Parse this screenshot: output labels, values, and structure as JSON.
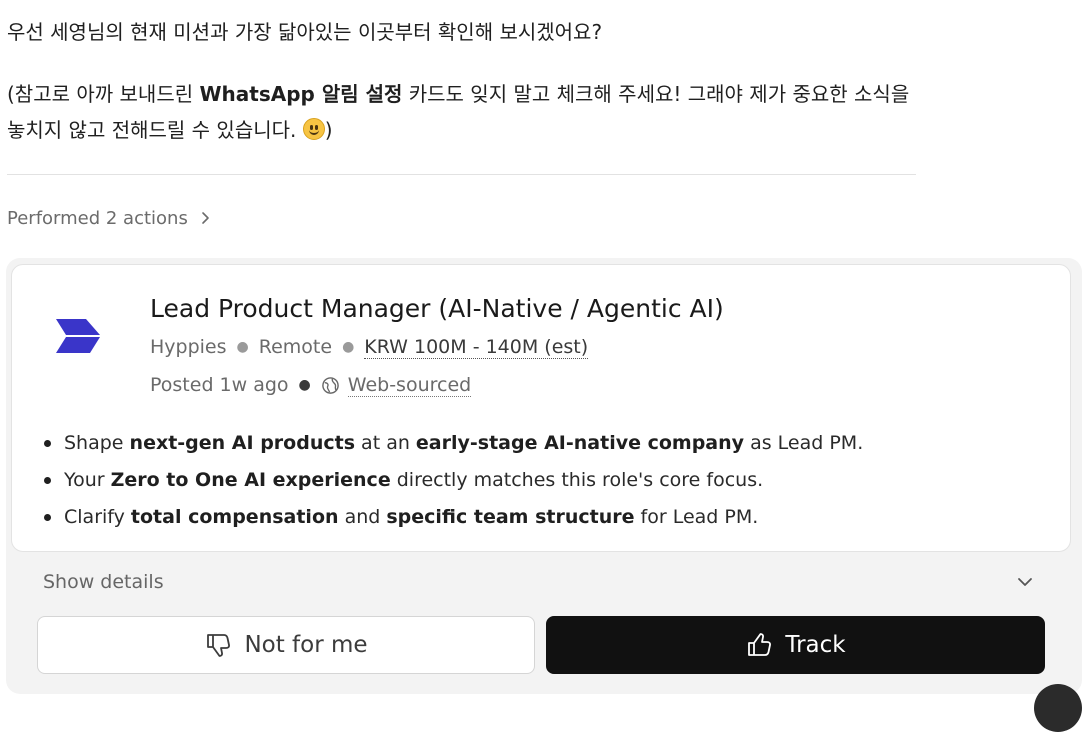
{
  "message": {
    "line1": "우선 세영님의 현재 미션과 가장 닮아있는 이곳부터 확인해 보시겠어요?",
    "line2_pre": "(참고로 아까 보내드린 ",
    "line2_bold": "WhatsApp 알림 설정",
    "line2_post": " 카드도 잊지 말고 체크해 주세요! 그래야 제가 중요한 소식을 놓치지 않고 전해드릴 수 있습니다. ",
    "line2_end": ")"
  },
  "actions": {
    "label": "Performed 2 actions"
  },
  "job": {
    "title": "Lead Product Manager (AI-Native / Agentic AI)",
    "company": "Hyppies",
    "location": "Remote",
    "salary": "KRW 100M - 140M (est)",
    "posted": "Posted 1w ago",
    "source": "Web-sourced",
    "logo_color": "#3a35c9",
    "bullets": [
      {
        "a": "Shape ",
        "b": "next-gen AI products",
        "c": " at an ",
        "d": "early-stage AI-native company",
        "e": " as Lead PM."
      },
      {
        "a": "Your ",
        "b": "Zero to One AI experience",
        "c": " directly matches this role's core focus.",
        "d": "",
        "e": ""
      },
      {
        "a": "Clarify ",
        "b": "total compensation",
        "c": " and ",
        "d": "specific team structure",
        "e": " for Lead PM."
      }
    ]
  },
  "details": {
    "label": "Show details"
  },
  "buttons": {
    "not_for_me": "Not for me",
    "track": "Track"
  },
  "icons": {
    "chevron": "chevron-right-icon",
    "globe": "globe-icon",
    "thumbs_down": "thumbs-down-icon",
    "thumbs_up": "thumbs-up-icon"
  }
}
